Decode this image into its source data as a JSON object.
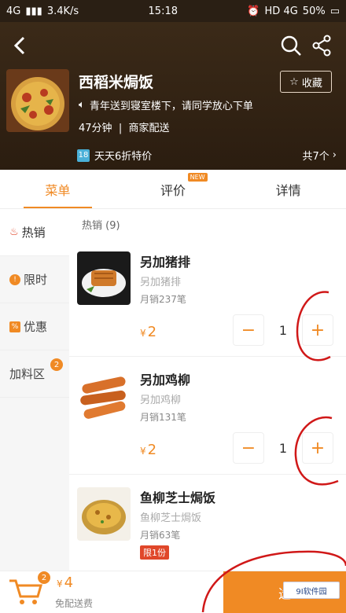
{
  "statusbar": {
    "network": "4G",
    "speed": "3.4K/s",
    "time": "15:18",
    "right": "HD 4G",
    "battery": "50%"
  },
  "shop": {
    "name": "西稻米焗饭",
    "favorite_label": "收藏",
    "notice": "青年送到寝室楼下，请同学放心下单",
    "delivery_time": "47分钟",
    "delivery_type": "商家配送",
    "promo_tag": "18",
    "promo_text": "天天6折特价",
    "promo_count": "共7个"
  },
  "tabs": [
    {
      "label": "菜单"
    },
    {
      "label": "评价",
      "badge": "NEW"
    },
    {
      "label": "详情"
    }
  ],
  "sidebar": [
    {
      "label": "热销"
    },
    {
      "label": "限时"
    },
    {
      "label": "优惠"
    },
    {
      "label": "加料区",
      "badge": "2"
    }
  ],
  "section_title": "热销 (9)",
  "items": [
    {
      "name": "另加猪排",
      "desc": "另加猪排",
      "sales": "月销237笔",
      "currency": "¥",
      "price": "2",
      "qty": "1"
    },
    {
      "name": "另加鸡柳",
      "desc": "另加鸡柳",
      "sales": "月销131笔",
      "currency": "¥",
      "price": "2",
      "qty": "1"
    },
    {
      "name": "鱼柳芝士焗饭",
      "desc": "鱼柳芝士焗饭",
      "sales": "月销63笔",
      "tag": "限1份"
    }
  ],
  "cart": {
    "badge": "2",
    "currency": "¥",
    "total": "4",
    "note": "免配送费",
    "checkout": "选"
  },
  "watermark": "9I软件园",
  "colors": {
    "accent": "#f08a24",
    "header_bg": "#2b1d10",
    "hot": "#e0472a"
  }
}
